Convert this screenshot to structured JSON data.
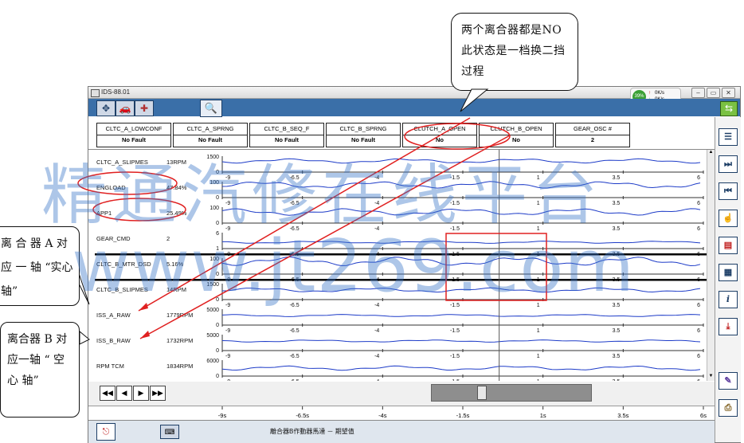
{
  "window": {
    "title": "IDS-88.01",
    "status_pill": {
      "percent": "39%",
      "line1": "0K/s",
      "line2": "0K/s"
    }
  },
  "pids": [
    {
      "name": "CLTC_A_LOWCONF",
      "value": "No Fault"
    },
    {
      "name": "CLTC_A_SPRNG",
      "value": "No Fault"
    },
    {
      "name": "CLTC_B_SEQ_F",
      "value": "No Fault"
    },
    {
      "name": "CLTC_B_SPRNG",
      "value": "No Fault"
    },
    {
      "name": "CLUTCH_A_OPEN",
      "value": "No"
    },
    {
      "name": "CLUTCH_B_OPEN",
      "value": "No"
    },
    {
      "name": "GEAR_OSC #",
      "value": "2"
    }
  ],
  "signals": [
    {
      "name": "CLTC_A_SLIPMES",
      "value": "13RPM",
      "ymax": "1500",
      "ymin": "0"
    },
    {
      "name": "ENGLOAD",
      "value": "47.84%",
      "ymax": "100",
      "ymin": "0"
    },
    {
      "name": "APP1",
      "value": "25.49%",
      "ymax": "100",
      "ymin": "0"
    },
    {
      "name": "GEAR_CMD",
      "value": "2",
      "ymax": "6",
      "ymin": "1"
    },
    {
      "name": "CLTC_B_MTR_DSD",
      "value": "5.16%",
      "ymax": "100",
      "ymin": "0"
    },
    {
      "name": "CLTC_B_SLIPMES",
      "value": "14RPM",
      "ymax": "1500",
      "ymin": "0"
    },
    {
      "name": "ISS_A_RAW",
      "value": "1779RPM",
      "ymax": "5000",
      "ymin": "0"
    },
    {
      "name": "ISS_B_RAW",
      "value": "1732RPM",
      "ymax": "5000",
      "ymin": "0"
    },
    {
      "name": "RPM TCM",
      "value": "1834RPM",
      "ymax": "6000",
      "ymin": "0"
    }
  ],
  "x_ticks": [
    "-9",
    "-6.5",
    "-4",
    "-1.5",
    "1",
    "3.5",
    "6"
  ],
  "time_axis": [
    "-9s",
    "-6.5s",
    "-4s",
    "-1.5s",
    "1s",
    "3.5s",
    "6s"
  ],
  "status_text": "離合器B作動器馬達 － 期望值",
  "callouts": {
    "top": "两个离合器都是NO  此状态是一档换二挡过程",
    "left_a": "离 合 器  A 对 应 一 轴 “实心轴”",
    "left_b": "离合器 B 对应一轴 “ 空 心 轴”"
  },
  "watermark": {
    "line1": "精通汽修在线平台",
    "line2": "www.jt269.com"
  },
  "colors": {
    "toolbar": "#3a6fa8",
    "trace": "#1e3cc8",
    "annotation": "#e02020",
    "sidebar_icon": "#1d3e66",
    "status_pill": "#3aa035",
    "watermark": "#3c78c8"
  }
}
